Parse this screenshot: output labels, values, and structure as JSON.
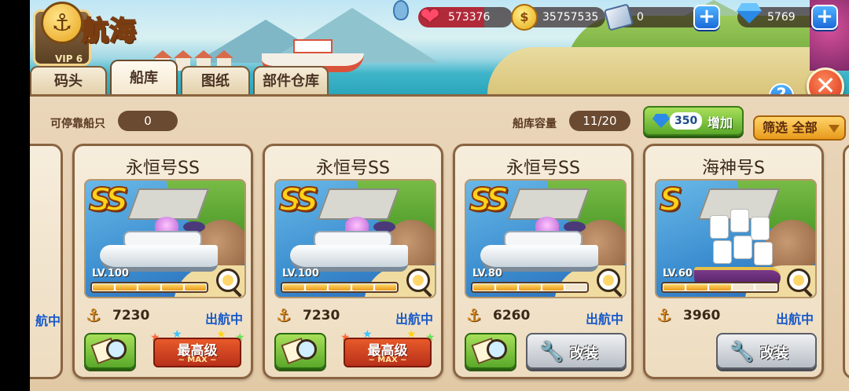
{
  "header": {
    "title": "航海",
    "vip_label": "VIP 6",
    "resources": {
      "hearts": "573376",
      "coins": "35757535",
      "tickets": "0",
      "gems": "5769"
    }
  },
  "tabs": [
    {
      "label": "码头",
      "active": false
    },
    {
      "label": "船库",
      "active": true
    },
    {
      "label": "图纸",
      "active": false
    },
    {
      "label": "部件仓库",
      "active": false
    }
  ],
  "info": {
    "dockable_label": "可停靠船只",
    "dockable_value": "0",
    "capacity_label": "船库容量",
    "capacity_value": "11/20",
    "expand_cost": "350",
    "expand_label": "增加",
    "filter_label": "筛选 全部"
  },
  "buttons": {
    "help": "?",
    "close": "✕"
  },
  "left_edge": {
    "status": "航中"
  },
  "cards": [
    {
      "name": "永恒号SS",
      "rank": "SS",
      "level": "LV.100",
      "level_fraction": 1.0,
      "power": "7230",
      "status": "出航中",
      "action": "max",
      "max_text": "最高级",
      "max_sub": "~ MAX ~"
    },
    {
      "name": "永恒号SS",
      "rank": "SS",
      "level": "LV.100",
      "level_fraction": 1.0,
      "power": "7230",
      "status": "出航中",
      "action": "max",
      "max_text": "最高级",
      "max_sub": "~ MAX ~"
    },
    {
      "name": "永恒号SS",
      "rank": "SS",
      "level": "LV.80",
      "level_fraction": 0.8,
      "power": "6260",
      "status": "出航中",
      "action": "modify",
      "modify_label": "改装"
    },
    {
      "name": "海神号S",
      "rank": "S",
      "level": "LV.60",
      "level_fraction": 0.6,
      "power": "3960",
      "status": "出航中",
      "action": "modify",
      "modify_label": "改装"
    }
  ],
  "colors": {
    "status_blue": "#1a5ac8",
    "accent_green": "#5aa82a",
    "brand_gold": "#e8a21a"
  }
}
